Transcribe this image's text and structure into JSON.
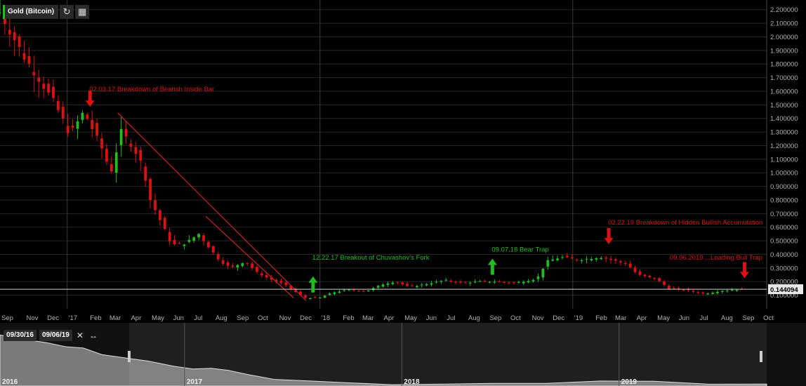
{
  "symbol": "Gold (Bitcoin)",
  "toolbar": {
    "refresh_icon": "refresh-icon",
    "chart_type_icon": "candlestick-icon"
  },
  "last_price": "0.144094",
  "range": {
    "start": "09/30/16",
    "end": "09/06/19",
    "close_icon": "close-icon",
    "expand_icon": "expand-icon"
  },
  "navigator_years": [
    "2016",
    "2017",
    "2018",
    "2019"
  ],
  "colors": {
    "up": "#22bb22",
    "down": "#dd1111",
    "trend": "#cc2222",
    "grid": "#262626",
    "bg": "#000000"
  },
  "chart_data": {
    "type": "candlestick",
    "title": "",
    "ylim": [
      0,
      2.25
    ],
    "y_ticks": [
      "2.200000",
      "2.100000",
      "2.000000",
      "1.900000",
      "1.800000",
      "1.700000",
      "1.600000",
      "1.500000",
      "1.400000",
      "1.300000",
      "1.200000",
      "1.100000",
      "1.000000",
      "0.900000",
      "0.800000",
      "0.700000",
      "0.600000",
      "0.500000",
      "0.400000",
      "0.300000",
      "0.200000",
      "0.100000"
    ],
    "y_tick_values": [
      2.2,
      2.1,
      2.0,
      1.9,
      1.8,
      1.7,
      1.6,
      1.5,
      1.4,
      1.3,
      1.2,
      1.1,
      1.0,
      0.9,
      0.8,
      0.7,
      0.6,
      0.5,
      0.4,
      0.3,
      0.2,
      0.1
    ],
    "x_range": [
      "2016-09-26",
      "2019-10-08"
    ],
    "x_ticks": [
      {
        "label": "Sep",
        "date": "2016-09-26"
      },
      {
        "label": "Nov",
        "date": "2016-11-01"
      },
      {
        "label": "Dec",
        "date": "2016-12-01"
      },
      {
        "label": "'17",
        "date": "2017-01-01"
      },
      {
        "label": "Feb",
        "date": "2017-02-01"
      },
      {
        "label": "Mar",
        "date": "2017-03-01"
      },
      {
        "label": "Apr",
        "date": "2017-04-01"
      },
      {
        "label": "May",
        "date": "2017-05-01"
      },
      {
        "label": "Jun",
        "date": "2017-06-01"
      },
      {
        "label": "Jul",
        "date": "2017-07-01"
      },
      {
        "label": "Aug",
        "date": "2017-08-01"
      },
      {
        "label": "Sep",
        "date": "2017-09-01"
      },
      {
        "label": "Oct",
        "date": "2017-10-01"
      },
      {
        "label": "Nov",
        "date": "2017-11-01"
      },
      {
        "label": "Dec",
        "date": "2017-12-01"
      },
      {
        "label": "'18",
        "date": "2018-01-01"
      },
      {
        "label": "Feb",
        "date": "2018-02-01"
      },
      {
        "label": "Mar",
        "date": "2018-03-01"
      },
      {
        "label": "Apr",
        "date": "2018-04-01"
      },
      {
        "label": "May",
        "date": "2018-05-01"
      },
      {
        "label": "Jun",
        "date": "2018-06-01"
      },
      {
        "label": "Jul",
        "date": "2018-07-01"
      },
      {
        "label": "Aug",
        "date": "2018-08-01"
      },
      {
        "label": "Sep",
        "date": "2018-09-01"
      },
      {
        "label": "Oct",
        "date": "2018-10-01"
      },
      {
        "label": "Nov",
        "date": "2018-11-01"
      },
      {
        "label": "Dec",
        "date": "2018-12-01"
      },
      {
        "label": "'19",
        "date": "2019-01-01"
      },
      {
        "label": "Feb",
        "date": "2019-02-01"
      },
      {
        "label": "Mar",
        "date": "2019-03-01"
      },
      {
        "label": "Apr",
        "date": "2019-04-01"
      },
      {
        "label": "May",
        "date": "2019-05-01"
      },
      {
        "label": "Jun",
        "date": "2019-06-01"
      },
      {
        "label": "Jul",
        "date": "2019-07-01"
      },
      {
        "label": "Aug",
        "date": "2019-08-01"
      },
      {
        "label": "Sep",
        "date": "2019-09-01"
      },
      {
        "label": "Oct",
        "date": "2019-10-01"
      }
    ],
    "year_lines": [
      "2017-01-01",
      "2018-01-01",
      "2019-01-01"
    ],
    "close_path": [
      [
        "2016-09-26",
        2.18
      ],
      [
        "2016-10-15",
        2.0
      ],
      [
        "2016-10-31",
        1.85
      ],
      [
        "2016-11-20",
        1.7
      ],
      [
        "2016-12-15",
        1.5
      ],
      [
        "2017-01-05",
        1.28
      ],
      [
        "2017-01-25",
        1.45
      ],
      [
        "2017-02-20",
        1.18
      ],
      [
        "2017-03-05",
        1.0
      ],
      [
        "2017-03-20",
        1.3
      ],
      [
        "2017-04-05",
        1.2
      ],
      [
        "2017-04-20",
        1.05
      ],
      [
        "2017-05-01",
        0.8
      ],
      [
        "2017-05-20",
        0.6
      ],
      [
        "2017-06-01",
        0.47
      ],
      [
        "2017-06-20",
        0.48
      ],
      [
        "2017-07-10",
        0.55
      ],
      [
        "2017-07-25",
        0.45
      ],
      [
        "2017-08-10",
        0.35
      ],
      [
        "2017-08-25",
        0.3
      ],
      [
        "2017-09-15",
        0.35
      ],
      [
        "2017-10-01",
        0.27
      ],
      [
        "2017-10-20",
        0.22
      ],
      [
        "2017-11-10",
        0.18
      ],
      [
        "2017-11-25",
        0.13
      ],
      [
        "2017-12-10",
        0.08
      ],
      [
        "2017-12-31",
        0.08
      ],
      [
        "2018-01-20",
        0.12
      ],
      [
        "2018-02-10",
        0.14
      ],
      [
        "2018-03-10",
        0.13
      ],
      [
        "2018-04-01",
        0.18
      ],
      [
        "2018-04-20",
        0.2
      ],
      [
        "2018-05-10",
        0.16
      ],
      [
        "2018-06-01",
        0.18
      ],
      [
        "2018-07-01",
        0.21
      ],
      [
        "2018-07-25",
        0.19
      ],
      [
        "2018-08-20",
        0.2
      ],
      [
        "2018-09-10",
        0.2
      ],
      [
        "2018-10-10",
        0.19
      ],
      [
        "2018-11-10",
        0.22
      ],
      [
        "2018-11-25",
        0.35
      ],
      [
        "2018-12-15",
        0.38
      ],
      [
        "2019-01-10",
        0.36
      ],
      [
        "2019-02-10",
        0.38
      ],
      [
        "2019-02-25",
        0.36
      ],
      [
        "2019-03-20",
        0.33
      ],
      [
        "2019-04-05",
        0.25
      ],
      [
        "2019-05-01",
        0.22
      ],
      [
        "2019-05-20",
        0.15
      ],
      [
        "2019-06-10",
        0.14
      ],
      [
        "2019-07-10",
        0.11
      ],
      [
        "2019-08-01",
        0.13
      ],
      [
        "2019-08-20",
        0.14
      ],
      [
        "2019-09-06",
        0.144
      ]
    ],
    "trendlines": [
      {
        "from": [
          "2017-03-15",
          1.44
        ],
        "to": [
          "2017-12-12",
          0.06
        ]
      },
      {
        "from": [
          "2017-07-20",
          0.68
        ],
        "to": [
          "2017-11-24",
          0.08
        ]
      }
    ],
    "horizontal_line": 0.144094,
    "annotations": [
      {
        "text": "02.03.17 Breakdown of Bearish Inside Bar",
        "date": "2017-02-02",
        "y": 1.6,
        "color": "#dd1111",
        "arrow": "down",
        "arrow_date": "2017-02-03",
        "arrow_y": 1.49
      },
      {
        "text": "12.22.17 Breakout of Chuvashov's Fork",
        "date": "2017-12-21",
        "y": 0.36,
        "color": "#22bb22",
        "arrow": "up",
        "arrow_date": "2017-12-22",
        "arrow_y": 0.12
      },
      {
        "text": "09.07.18 Bear Trap",
        "date": "2018-09-06",
        "y": 0.42,
        "color": "#22bb22",
        "arrow": "up",
        "arrow_date": "2018-09-07",
        "arrow_y": 0.25
      },
      {
        "text": "02.22.19 Breakdown of Hidden Bullish Accumulation",
        "date": "2019-02-21",
        "y": 0.62,
        "color": "#dd1111",
        "arrow": "down",
        "arrow_date": "2019-02-22",
        "arrow_y": 0.48
      },
      {
        "text": "09.06.2019 ...Loading Bull Trap",
        "date": "2019-05-21",
        "y": 0.36,
        "color": "#dd1111",
        "arrow": "down",
        "arrow_date": "2019-09-06",
        "arrow_y": 0.23
      }
    ],
    "navigator": {
      "x_range": [
        "2016-02-26",
        "2019-09-06"
      ],
      "y_range": [
        0,
        4.5
      ],
      "y_ticks": [],
      "path": [
        [
          "2016-02-26",
          3.9
        ],
        [
          "2016-04-01",
          3.6
        ],
        [
          "2016-05-15",
          3.3
        ],
        [
          "2016-06-15",
          3.0
        ],
        [
          "2016-07-15",
          2.9
        ],
        [
          "2016-08-15",
          2.4
        ],
        [
          "2016-09-30",
          2.1
        ],
        [
          "2016-11-01",
          1.9
        ],
        [
          "2016-12-15",
          1.5
        ],
        [
          "2017-01-15",
          1.3
        ],
        [
          "2017-02-15",
          1.35
        ],
        [
          "2017-03-15",
          1.2
        ],
        [
          "2017-04-15",
          0.9
        ],
        [
          "2017-06-01",
          0.5
        ],
        [
          "2017-08-01",
          0.38
        ],
        [
          "2017-10-01",
          0.25
        ],
        [
          "2017-12-15",
          0.1
        ],
        [
          "2018-03-01",
          0.14
        ],
        [
          "2018-06-01",
          0.2
        ],
        [
          "2018-09-01",
          0.2
        ],
        [
          "2018-12-01",
          0.38
        ],
        [
          "2019-03-01",
          0.36
        ],
        [
          "2019-06-01",
          0.14
        ],
        [
          "2019-09-06",
          0.144
        ]
      ],
      "year_lines": [
        "2017-01-01",
        "2018-01-01",
        "2019-01-01"
      ]
    }
  }
}
